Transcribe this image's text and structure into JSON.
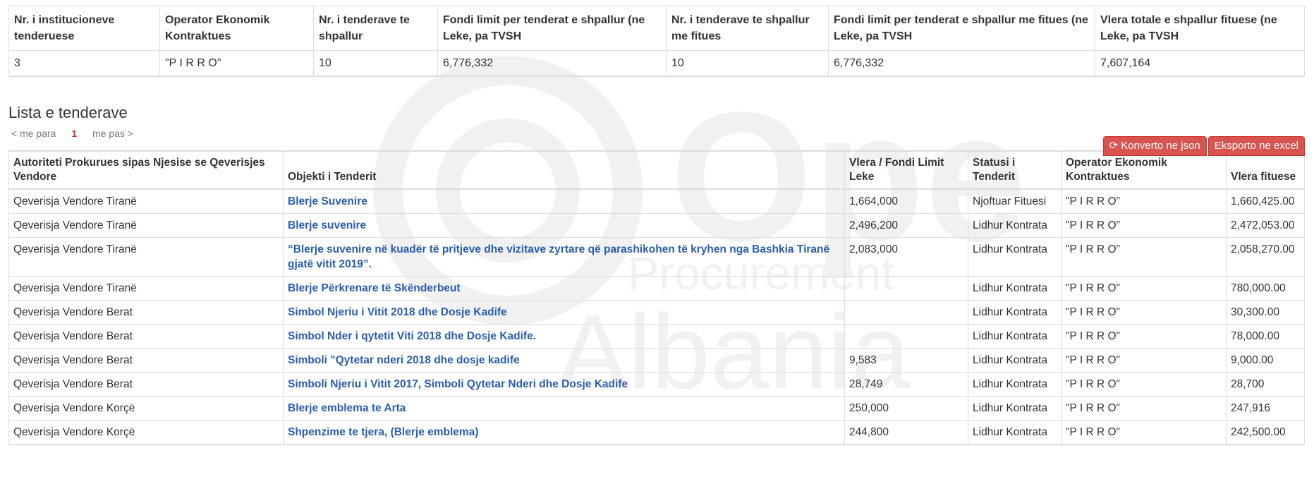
{
  "summary": {
    "headers": [
      "Nr. i institucioneve tenderuese",
      "Operator Ekonomik Kontraktues",
      "Nr. i tenderave te shpallur",
      "Fondi limit per tenderat e shpallur (ne Leke, pa TVSH",
      "Nr. i tenderave te shpallur me fitues",
      "Fondi limit per tenderat e shpallur me fitues (ne Leke, pa TVSH",
      "Vlera totale e shpallur fituese (ne Leke, pa TVSH"
    ],
    "row": [
      "3",
      "\"P I R R O\"",
      "10",
      "6,776,332",
      "10",
      "6,776,332",
      "7,607,164"
    ]
  },
  "section_title": "Lista e tenderave",
  "pager": {
    "prev": "< me para",
    "current": "1",
    "next": "me pas >"
  },
  "buttons": {
    "json": "Konverto ne json",
    "excel": "Eksporto ne excel"
  },
  "watermark": {
    "line1": "Open",
    "line2": "Procurement",
    "line3": "Albania"
  },
  "colors": {
    "accent": "#d9534f",
    "link": "#2a5db0",
    "page_current": "#c9302c"
  },
  "tenders": {
    "headers": [
      "Autoriteti Prokurues sipas Njesise se Qeverisjes Vendore",
      "Objekti i Tenderit",
      "Vlera / Fondi Limit Leke",
      "Statusi i Tenderit",
      "Operator Ekonomik Kontraktues",
      "Vlera fituese"
    ],
    "rows": [
      [
        "Qeverisja Vendore Tiranë",
        "Blerje Suvenire",
        "1,664,000",
        "Njoftuar Fituesi",
        "\"P I R R O\"",
        "1,660,425.00"
      ],
      [
        "Qeverisja Vendore Tiranë",
        "Blerje suvenire",
        "2,496,200",
        "Lidhur Kontrata",
        "\"P I R R O\"",
        "2,472,053.00"
      ],
      [
        "Qeverisja Vendore Tiranë",
        "“Blerje suvenire në kuadër të pritjeve dhe vizitave zyrtare që parashikohen të kryhen nga Bashkia Tiranë gjatë vitit 2019”.",
        "2,083,000",
        "Lidhur Kontrata",
        "\"P I R R O\"",
        "2,058,270.00"
      ],
      [
        "Qeverisja Vendore Tiranë",
        "Blerje Përkrenare të Skënderbeut",
        "",
        "Lidhur Kontrata",
        "\"P I R R O\"",
        "780,000.00"
      ],
      [
        "Qeverisja Vendore Berat",
        "Simbol Njeriu i Vitit 2018 dhe Dosje Kadife",
        "",
        "Lidhur Kontrata",
        "\"P I R R O\"",
        "30,300.00"
      ],
      [
        "Qeverisja Vendore Berat",
        "Simbol Nder i qytetit Viti 2018 dhe Dosje Kadife.",
        "",
        "Lidhur Kontrata",
        "\"P I R R O\"",
        "78,000.00"
      ],
      [
        "Qeverisja Vendore Berat",
        "Simboli \"Qytetar nderi 2018 dhe dosje kadife",
        "9,583",
        "Lidhur Kontrata",
        "\"P I R R O\"",
        "9,000.00"
      ],
      [
        "Qeverisja Vendore Berat",
        "Simboli Njeriu i Vitit 2017, Simboli Qytetar Nderi dhe Dosje Kadife",
        "28,749",
        "Lidhur Kontrata",
        "\"P I R R O\"",
        "28,700"
      ],
      [
        "Qeverisja Vendore Korçë",
        "Blerje emblema te Arta",
        "250,000",
        "Lidhur Kontrata",
        "\"P I R R O\"",
        "247,916"
      ],
      [
        "Qeverisja Vendore Korçë",
        "Shpenzime te tjera, (Blerje emblema)",
        "244,800",
        "Lidhur Kontrata",
        "\"P I R R O\"",
        "242,500.00"
      ]
    ]
  }
}
